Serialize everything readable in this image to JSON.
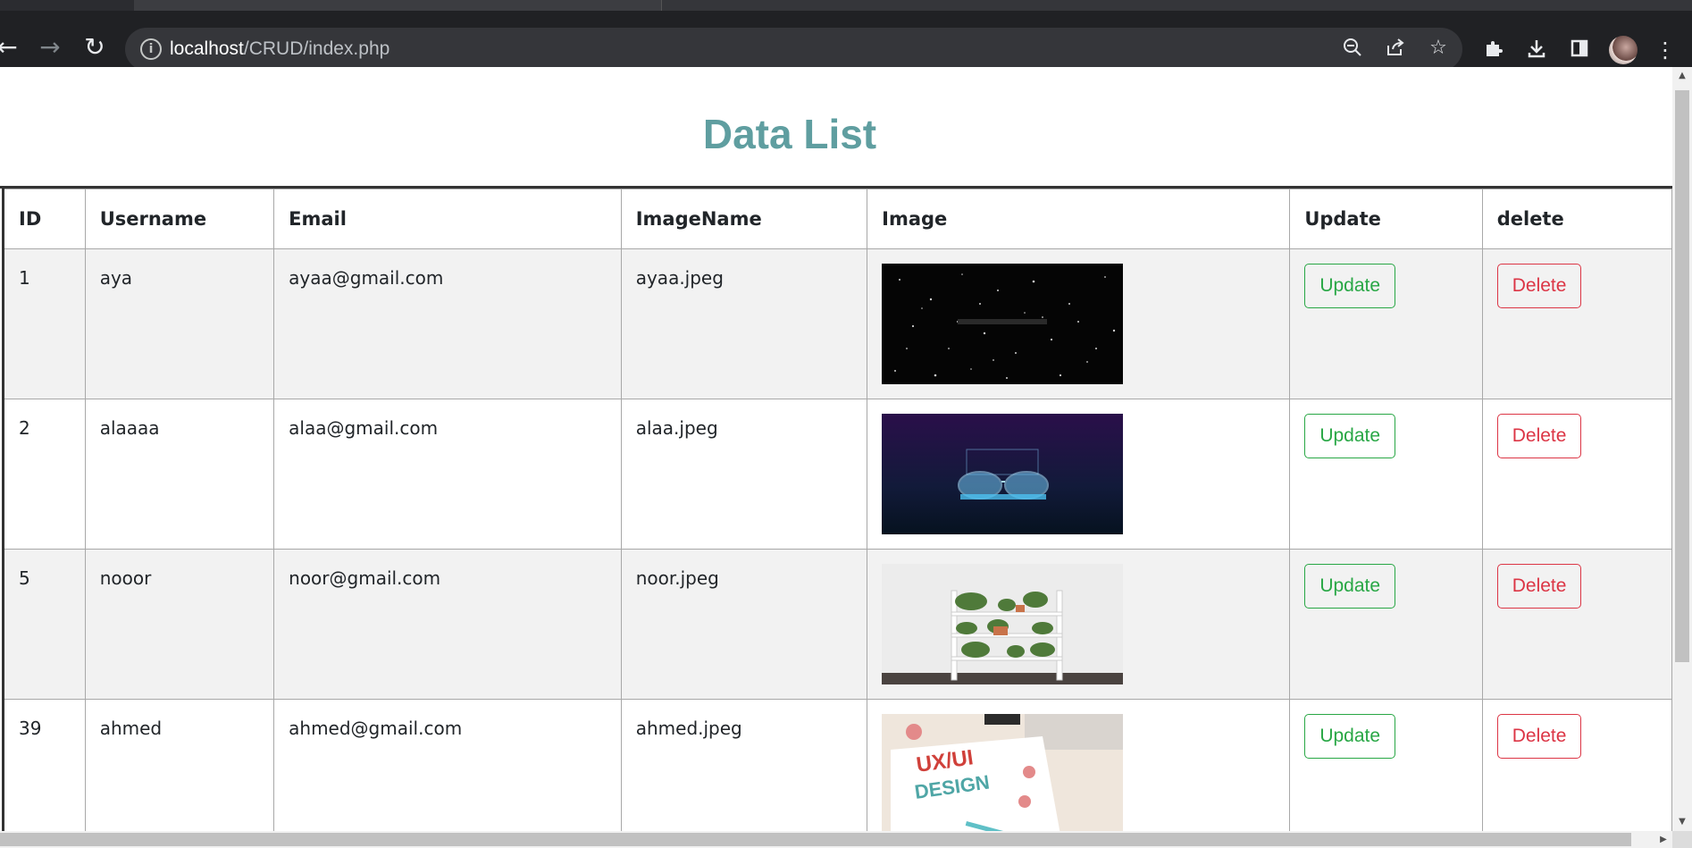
{
  "browser": {
    "url_host": "localhost",
    "url_path": "/CRUD/index.php"
  },
  "page": {
    "title": "Data List",
    "columns": [
      "ID",
      "Username",
      "Email",
      "ImageName",
      "Image",
      "Update",
      "delete"
    ],
    "rows": [
      {
        "id": "1",
        "username": "aya",
        "email": "ayaa@gmail.com",
        "image_name": "ayaa.jpeg",
        "update_label": "Update",
        "delete_label": "Delete"
      },
      {
        "id": "2",
        "username": "alaaaa",
        "email": "alaa@gmail.com",
        "image_name": "alaa.jpeg",
        "update_label": "Update",
        "delete_label": "Delete"
      },
      {
        "id": "5",
        "username": "nooor",
        "email": "noor@gmail.com",
        "image_name": "noor.jpeg",
        "update_label": "Update",
        "delete_label": "Delete"
      },
      {
        "id": "39",
        "username": "ahmed",
        "email": "ahmed@gmail.com",
        "image_name": "ahmed.jpeg",
        "update_label": "Update",
        "delete_label": "Delete"
      }
    ],
    "thumb_texts": {
      "ahmed_line1": "UX/UI",
      "ahmed_line2": "DESIGN"
    }
  },
  "colors": {
    "title": "#5f9ea0",
    "update": "#28a745",
    "delete": "#dc3545",
    "row_stripe": "#f2f2f2"
  },
  "icons": {
    "back": "back-arrow-icon",
    "forward": "forward-arrow-icon",
    "reload": "reload-icon",
    "site_info": "info-icon",
    "zoom": "zoom-out-icon",
    "share": "share-icon",
    "bookmark": "star-icon",
    "extensions": "puzzle-icon",
    "downloads": "download-icon",
    "side_panel": "side-panel-icon",
    "menu": "kebab-menu-icon"
  }
}
